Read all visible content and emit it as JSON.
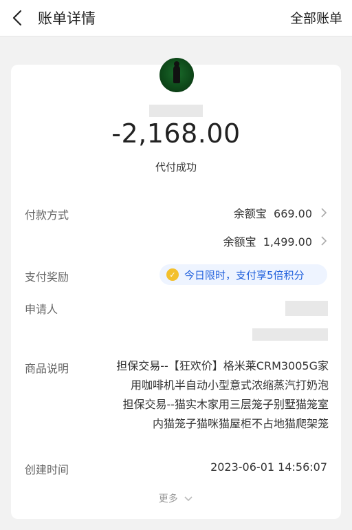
{
  "header": {
    "title": "账单详情",
    "right_action": "全部账单"
  },
  "summary": {
    "amount": "-2,168.00",
    "status": "代付成功"
  },
  "payment": {
    "label": "付款方式",
    "methods": [
      {
        "name": "余额宝",
        "amount": "669.00"
      },
      {
        "name": "余额宝",
        "amount": "1,499.00"
      }
    ]
  },
  "reward": {
    "label": "支付奖励",
    "text": "今日限时，支付享5倍积分",
    "icon": "coin-check-icon",
    "color": "#1f5fdc"
  },
  "requester": {
    "label": "申请人"
  },
  "product": {
    "label": "商品说明",
    "lines": [
      "担保交易--【狂欢价】格米莱CRM3005G家",
      "用咖啡机半自动小型意式浓缩蒸汽打奶泡",
      "担保交易--猫实木家用三层笼子别墅猫笼室",
      "内猫笼子猫咪猫屋柜不占地猫爬架笼"
    ]
  },
  "created": {
    "label": "创建时间",
    "value": "2023-06-01 14:56:07"
  },
  "more": {
    "label": "更多"
  }
}
